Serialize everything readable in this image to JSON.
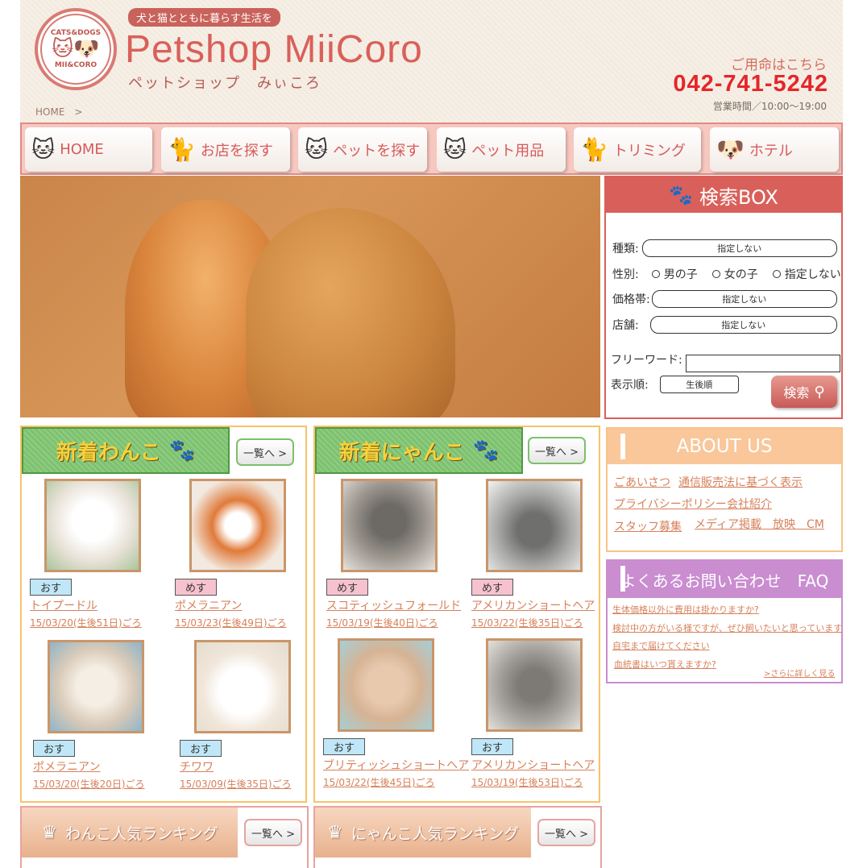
{
  "header": {
    "tagline": "犬と猫とともに暮らす生活を",
    "brand": "Petshop MiiCoro",
    "brand_kana": "ペットショップ　みぃころ",
    "logo_top": "CATS&DOGS",
    "logo_bottom": "MII&CORO",
    "breadcrumb": "HOME　>",
    "contact_label": "ご用命はこちら",
    "phone": "042-741-5242",
    "hours": "営業時間／10:00〜19:00"
  },
  "nav": {
    "items": [
      {
        "label": "HOME",
        "icon": "cat-icon"
      },
      {
        "label": "お店を探す",
        "icon": "cat-dog-icon"
      },
      {
        "label": "ペットを探す",
        "icon": "cat-icon"
      },
      {
        "label": "ペット用品",
        "icon": "cat-icon"
      },
      {
        "label": "トリミング",
        "icon": "cat-icon"
      },
      {
        "label": "ホテル",
        "icon": "dog-icon"
      }
    ]
  },
  "search": {
    "title": "検索BOX",
    "kind_label": "種類:",
    "kind_value": "指定しない",
    "sex_label": "性別:",
    "sex_options": [
      "男の子",
      "女の子",
      "指定しない"
    ],
    "price_label": "価格帯:",
    "price_value": "指定しない",
    "store_label": "店舗:",
    "store_value": "指定しない",
    "freeword_label": "フリーワード:",
    "freeword_value": "",
    "order_label": "表示順:",
    "order_value": "生後順",
    "button": "検索"
  },
  "new_dogs": {
    "title": "新着わんこ",
    "list_button": "一覧へ >",
    "items": [
      {
        "sex": "おす",
        "breed": "トイプードル",
        "date": "15/03/20(生後51日)ごろ",
        "color": "#f3f0ea"
      },
      {
        "sex": "めす",
        "breed": "ポメラニアン",
        "date": "15/03/23(生後49日)ごろ",
        "color": "#d98a4a"
      },
      {
        "sex": "おす",
        "breed": "ポメラニアン",
        "date": "15/03/20(生後20日)ごろ",
        "color": "#efe6da"
      },
      {
        "sex": "おす",
        "breed": "チワワ",
        "date": "15/03/09(生後35日)ごろ",
        "color": "#f7f2ec"
      }
    ]
  },
  "new_cats": {
    "title": "新着にゃんこ",
    "list_button": "一覧へ >",
    "items": [
      {
        "sex": "めす",
        "breed": "スコティッシュフォールド",
        "date": "15/03/19(生後40日)ごろ",
        "color": "#8a8680"
      },
      {
        "sex": "めす",
        "breed": "アメリカンショートヘア",
        "date": "15/03/22(生後35日)ごろ",
        "color": "#9a9a98"
      },
      {
        "sex": "おす",
        "breed": "ブリティッシュショートヘア",
        "date": "15/03/22(生後45日)ごろ",
        "color": "#e0c2a6"
      },
      {
        "sex": "おす",
        "breed": "アメリカンショートヘア",
        "date": "15/03/19(生後53日)ごろ",
        "color": "#8d8a86"
      }
    ]
  },
  "about": {
    "title": "ABOUT US",
    "links": [
      "ごあいさつ",
      "通信販売法に基づく表示",
      "プライバシーポリシー",
      "会社紹介",
      "スタッフ募集",
      "メディア掲載　放映　CM"
    ]
  },
  "faq": {
    "title": "よくあるお問い合わせ　FAQ",
    "items": [
      "生体価格以外に費用は掛かりますか?",
      "検討中の方がいる様ですが、ぜひ飼いたいと思っています",
      "自宅まで届けてください",
      "血統書はいつ貰えますか?"
    ],
    "more": ">さらに詳しく見る"
  },
  "ranking": {
    "dog_title": "わんこ人気ランキング",
    "cat_title": "にゃんこ人気ランキング",
    "list_button": "一覧へ >"
  }
}
